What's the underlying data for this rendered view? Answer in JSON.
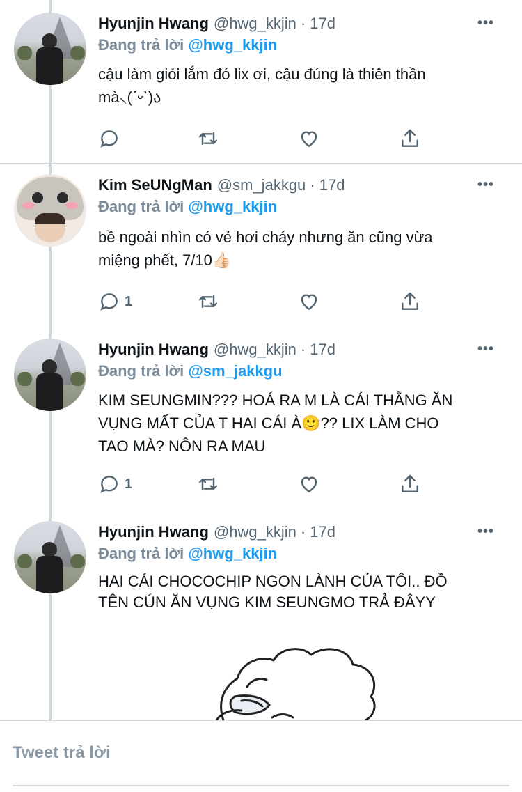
{
  "thread": [
    {
      "author": "Hyunjin Hwang",
      "handle": "@hwg_kkjin",
      "time": "· 17d",
      "reply_prefix": "Đang trả lời",
      "reply_mention": "@hwg_kkjin",
      "text_lines": [
        "cậu làm giỏi lắm đó lix ơi, cậu đúng là thiên thần",
        "mà⸜(ˊᵕˋ)ა"
      ],
      "reply_count": "",
      "avatar": "hyunjin-avatar"
    },
    {
      "author": "Kim SeUNgMan",
      "handle": "@sm_jakkgu",
      "time": "· 17d",
      "reply_prefix": "Đang trả lời",
      "reply_mention": "@hwg_kkjin",
      "text_lines": [
        "bề ngoài nhìn có vẻ hơi cháy nhưng ăn cũng vừa",
        "miệng phết, 7/10👍🏻"
      ],
      "reply_count": "1",
      "avatar": "seungmin-avatar"
    },
    {
      "author": "Hyunjin Hwang",
      "handle": "@hwg_kkjin",
      "time": "· 17d",
      "reply_prefix": "Đang trả lời",
      "reply_mention": "@sm_jakkgu",
      "text_lines": [
        "KIM SEUNGMIN??? HOÁ RA M LÀ CÁI THẰNG ĂN",
        "VỤNG MẤT CỦA T HAI CÁI À🙂?? LIX LÀM CHO",
        "TAO MÀ? NÔN RA MAU"
      ],
      "reply_count": "1",
      "avatar": "hyunjin-avatar"
    },
    {
      "author": "Hyunjin Hwang",
      "handle": "@hwg_kkjin",
      "time": "· 17d",
      "reply_prefix": "Đang trả lời",
      "reply_mention": "@hwg_kkjin",
      "text_lines": [
        "HAI CÁI CHOCOCHIP NGON LÀNH CỦA TÔI.. ĐỒ",
        "TÊN CÚN ĂN VỤNG KIM SEUNGMO TRẢ ĐÂYY"
      ],
      "reply_count": "",
      "avatar": "hyunjin-avatar"
    }
  ],
  "icons": {
    "more": "more-icon",
    "reply": "reply-icon",
    "retweet": "retweet-icon",
    "like": "like-icon",
    "share": "share-icon"
  },
  "compose": {
    "placeholder": "Tweet trả lời"
  },
  "colors": {
    "accent": "#1d9bf0",
    "muted": "#536471",
    "divider": "#cfd9de"
  }
}
